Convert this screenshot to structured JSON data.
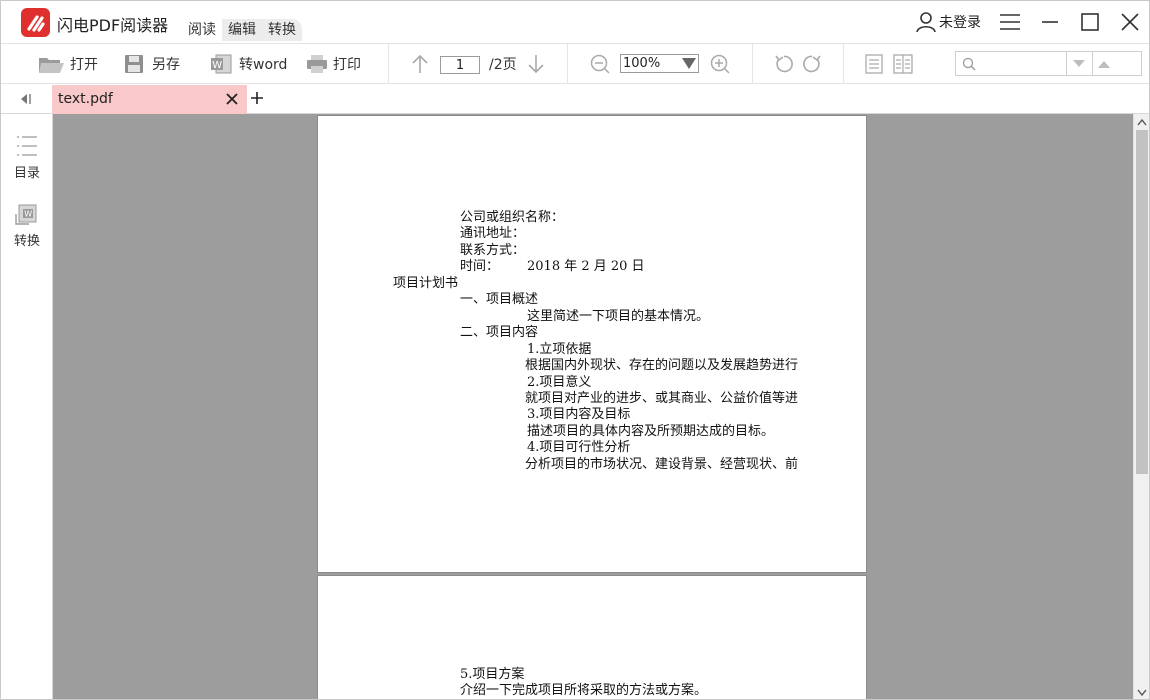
{
  "app": {
    "title": "闪电PDF阅读器",
    "menu": [
      "阅读",
      "编辑",
      "转换"
    ],
    "user_label": "未登录"
  },
  "toolbar": {
    "open_label": "打开",
    "save_as_label": "另存",
    "to_word_label": "转word",
    "print_label": "打印",
    "page_current": "1",
    "page_total": "/2页",
    "zoom_value": "100%"
  },
  "tabs": [
    {
      "label": "text.pdf",
      "active": true
    }
  ],
  "sidebar": {
    "items": [
      {
        "label": "目录",
        "icon": "toc-icon"
      },
      {
        "label": "转换",
        "icon": "convert-icon"
      }
    ]
  },
  "document": {
    "page1": [
      "公司或组织名称：",
      "通讯地址：",
      "联系方式：",
      "时间：",
      "2018 年 2 月 20 日",
      "项目计划书",
      "一、项目概述",
      "这里简述一下项目的基本情况。",
      "二、项目内容",
      "1.立项依据",
      "根据国内外现状、存在的问题以及发展趋势进行",
      "2.项目意义",
      "就项目对产业的进步、或其商业、公益价值等进",
      "3.项目内容及目标",
      "描述项目的具体内容及所预期达成的目标。",
      "4.项目可行性分析",
      "分析项目的市场状况、建设背景、经营现状、前"
    ],
    "page2": [
      "5.项目方案",
      "介绍一下完成项目所将采取的方法或方案。"
    ]
  },
  "colors": {
    "logo": "#e0302e",
    "active_tab": "#f9c8c8",
    "viewer_bg": "#9d9d9d"
  }
}
